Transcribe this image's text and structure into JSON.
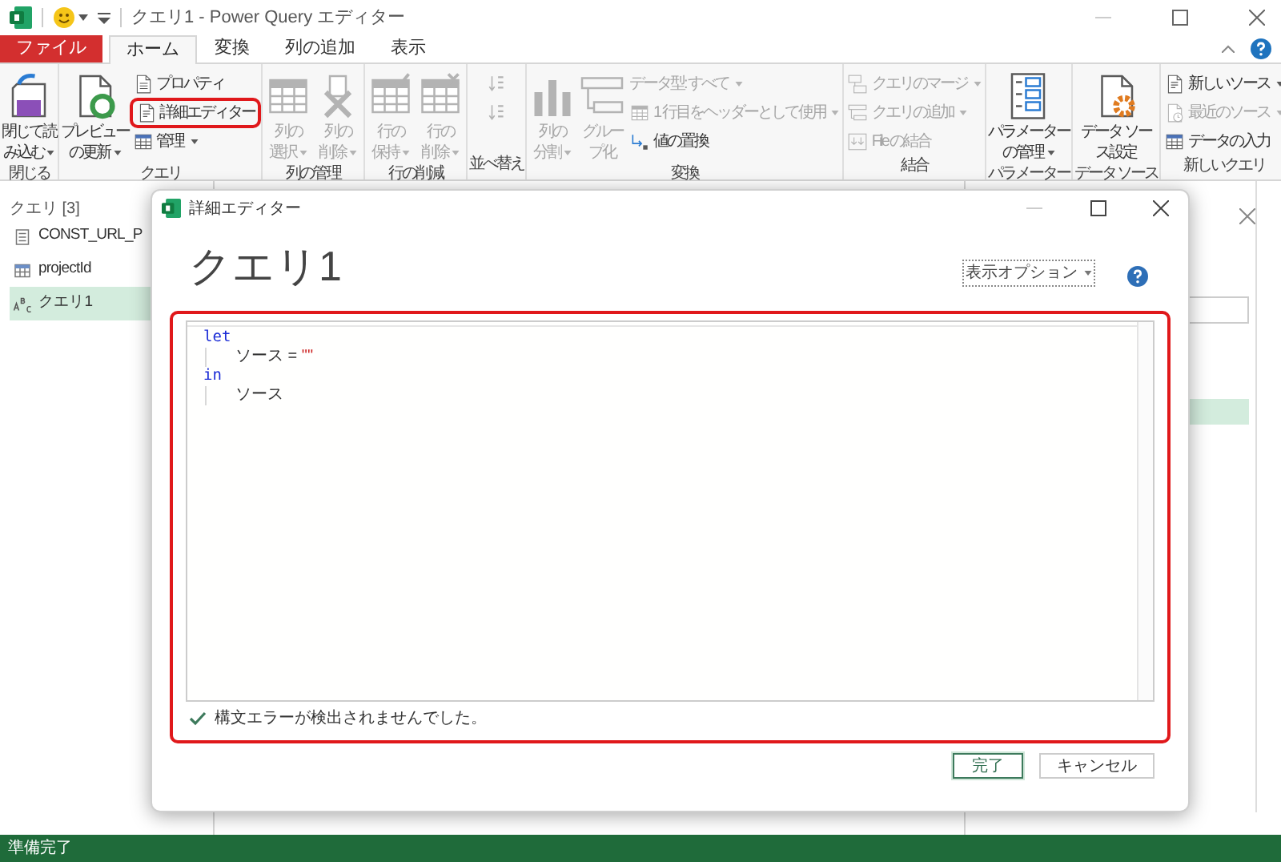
{
  "window": {
    "title": "クエリ1 - Power Query エディター"
  },
  "tabs": [
    {
      "label": "ファイル",
      "kind": "file",
      "selected": false
    },
    {
      "label": "ホーム",
      "kind": "tab",
      "selected": true
    },
    {
      "label": "変換",
      "kind": "tab",
      "selected": false
    },
    {
      "label": "列の追加",
      "kind": "tab",
      "selected": false
    },
    {
      "label": "表示",
      "kind": "tab",
      "selected": false
    }
  ],
  "ribbon": {
    "groups": [
      {
        "label": "閉じる",
        "items": [
          {
            "kind": "large",
            "lines": [
              "閉じて読",
              "み込む"
            ],
            "dropdown": true,
            "disabled": false
          }
        ]
      },
      {
        "label": "クエリ",
        "items": [
          {
            "kind": "large",
            "lines": [
              "プレビュー",
              "の更新"
            ],
            "dropdown": true,
            "disabled": false
          },
          {
            "kind": "small",
            "lines": [
              "プロパティ"
            ],
            "dropdown": false,
            "disabled": false
          },
          {
            "kind": "small",
            "lines": [
              "詳細エディター"
            ],
            "dropdown": false,
            "disabled": false,
            "highlighted": true
          },
          {
            "kind": "small",
            "lines": [
              "管理"
            ],
            "dropdown": true,
            "disabled": false
          }
        ]
      },
      {
        "label": "列の管理",
        "items": [
          {
            "kind": "large",
            "lines": [
              "列の",
              "選択"
            ],
            "dropdown": true,
            "disabled": true
          },
          {
            "kind": "large",
            "lines": [
              "列の",
              "削除"
            ],
            "dropdown": true,
            "disabled": true
          }
        ]
      },
      {
        "label": "行の削減",
        "items": [
          {
            "kind": "large",
            "lines": [
              "行の",
              "保持"
            ],
            "dropdown": true,
            "disabled": true
          },
          {
            "kind": "large",
            "lines": [
              "行の",
              "削除"
            ],
            "dropdown": true,
            "disabled": true
          }
        ]
      },
      {
        "label": "並べ替え",
        "items": [
          {
            "kind": "icon",
            "disabled": true
          },
          {
            "kind": "icon",
            "disabled": true
          }
        ]
      },
      {
        "label": "変換",
        "items": [
          {
            "kind": "large",
            "lines": [
              "列の",
              "分割"
            ],
            "dropdown": true,
            "disabled": true
          },
          {
            "kind": "large",
            "lines": [
              "グルー",
              "プ化"
            ],
            "dropdown": false,
            "disabled": true
          },
          {
            "kind": "small",
            "lines": [
              "データ型: すべて"
            ],
            "dropdown": true,
            "disabled": true
          },
          {
            "kind": "small",
            "lines": [
              "1 行目をヘッダーとして使用"
            ],
            "dropdown": true,
            "disabled": true
          },
          {
            "kind": "small",
            "lines": [
              "値の置換"
            ],
            "dropdown": false,
            "disabled": false
          }
        ]
      },
      {
        "label": "結合",
        "items": [
          {
            "kind": "small",
            "lines": [
              "クエリのマージ"
            ],
            "dropdown": true,
            "disabled": true
          },
          {
            "kind": "small",
            "lines": [
              "クエリの追加"
            ],
            "dropdown": true,
            "disabled": true
          },
          {
            "kind": "small",
            "lines": [
              "File の結合"
            ],
            "dropdown": false,
            "disabled": true
          }
        ]
      },
      {
        "label": "パラメーター",
        "items": [
          {
            "kind": "large",
            "lines": [
              "パラメーター",
              "の管理"
            ],
            "dropdown": true,
            "disabled": false
          }
        ]
      },
      {
        "label": "データ ソース",
        "items": [
          {
            "kind": "large",
            "lines": [
              "データ ソー",
              "ス設定"
            ],
            "dropdown": false,
            "disabled": false
          }
        ]
      },
      {
        "label": "新しいクエリ",
        "items": [
          {
            "kind": "small",
            "lines": [
              "新しいソース"
            ],
            "dropdown": true,
            "disabled": false
          },
          {
            "kind": "small",
            "lines": [
              "最近のソース"
            ],
            "dropdown": true,
            "disabled": true
          },
          {
            "kind": "small",
            "lines": [
              "データの入力"
            ],
            "dropdown": false,
            "disabled": false
          }
        ]
      }
    ]
  },
  "queries": {
    "header": "クエリ [3]",
    "items": [
      {
        "label": "CONST_URL_P",
        "selected": false
      },
      {
        "label": "projectId",
        "selected": false
      },
      {
        "label": "クエリ1",
        "selected": true
      }
    ]
  },
  "dialog": {
    "title": "詳細エディター",
    "heading": "クエリ1",
    "options_label": "表示オプション",
    "code": [
      {
        "tokens": [
          {
            "text": "let",
            "kind": "keyword"
          }
        ],
        "children": [
          {
            "tokens": [
              {
                "text": "ソース = ",
                "kind": "plain"
              },
              {
                "text": "\"\"",
                "kind": "string"
              }
            ]
          }
        ]
      },
      {
        "tokens": [
          {
            "text": "in",
            "kind": "keyword"
          }
        ],
        "children": [
          {
            "tokens": [
              {
                "text": "ソース",
                "kind": "plain"
              }
            ]
          }
        ]
      }
    ],
    "message": "構文エラーが検出されませんでした。",
    "buttons": [
      {
        "label": "完了",
        "primary": true
      },
      {
        "label": "キャンセル",
        "primary": false
      }
    ]
  },
  "status_bar": {
    "text": "準備完了"
  }
}
